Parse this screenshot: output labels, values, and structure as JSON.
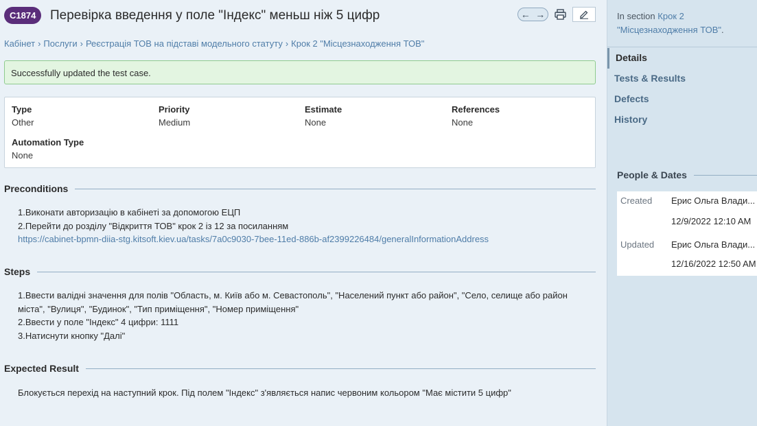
{
  "header": {
    "case_id": "C1874",
    "title": "Перевірка введення у поле \"Індекс\" меньш ніж 5 цифр",
    "prev_arrow": "←",
    "next_arrow": "→"
  },
  "breadcrumb": [
    "Кабінет",
    "Послуги",
    "Реєстрація ТОВ на підставі модельного статуту",
    "Крок 2 \"Місцезнаходження ТОВ\""
  ],
  "breadcrumb_sep": "›",
  "success_message": "Successfully updated the test case.",
  "fields": {
    "type": {
      "label": "Type",
      "value": "Other"
    },
    "priority": {
      "label": "Priority",
      "value": "Medium"
    },
    "estimate": {
      "label": "Estimate",
      "value": "None"
    },
    "references": {
      "label": "References",
      "value": "None"
    },
    "automation_type": {
      "label": "Automation Type",
      "value": "None"
    }
  },
  "preconditions": {
    "title": "Preconditions",
    "lines": [
      "1.Виконати авторизацію в кабінеті за допомогою ЕЦП",
      "2.Перейти до розділу \"Відкриття ТОВ\" крок 2 із 12 за посиланням"
    ],
    "link": "https://cabinet-bpmn-diia-stg.kitsoft.kiev.ua/tasks/7a0c9030-7bee-11ed-886b-af2399226484/generalInformationAddress"
  },
  "steps": {
    "title": "Steps",
    "lines": [
      "1.Ввести валідні значення для полів \"Область, м. Київ або м. Севастополь\", \"Населений пункт або район\", \"Село, селище або район",
      "міста\", \"Вулиця\", \"Будинок\", \"Тип приміщення\", \"Номер приміщення\"",
      "2.Ввести у поле \"Індекс\" 4 цифри: 1111",
      "3.Натиснути кнопку \"Далі\""
    ]
  },
  "expected": {
    "title": "Expected Result",
    "text": "Блокується перехід на наступний крок. Під полем \"Індекс\" з'являється напис червоним кольором \"Має містити 5 цифр\""
  },
  "sidebar": {
    "in_section_prefix": "In section",
    "in_section_link": "Крок 2 \"Місцезнаходження ТОВ\"",
    "in_section_suffix": ".",
    "nav": [
      "Details",
      "Tests & Results",
      "Defects",
      "History"
    ],
    "active_nav": "Details",
    "people_title": "People & Dates",
    "created_label": "Created",
    "created_by": "Ерис Ольга Влади...",
    "created_at": "12/9/2022 12:10 AM",
    "updated_label": "Updated",
    "updated_by": "Ерис Ольга Влади...",
    "updated_at": "12/16/2022 12:50 AM"
  },
  "colors": {
    "case_badge": "#5a2d7a",
    "link": "#4f7da8",
    "success_bg": "#e3f5e1",
    "success_border": "#8ecb8e"
  }
}
